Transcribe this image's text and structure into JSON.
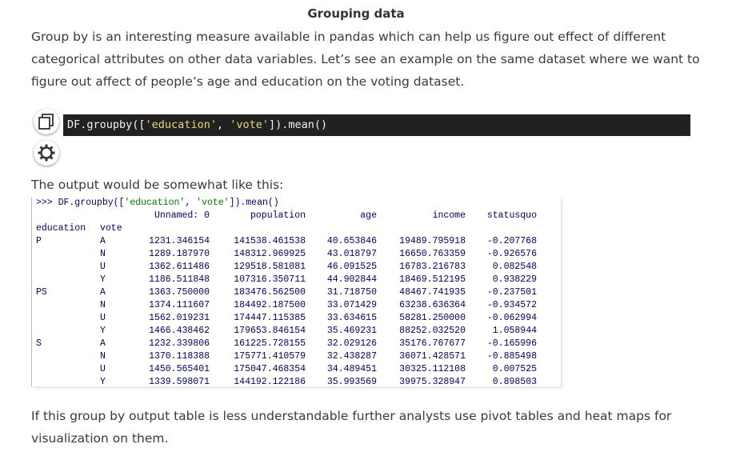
{
  "heading": "Grouping data",
  "intro": "Group by is an interesting measure available in pandas which can help us figure out effect of different categorical attributes on other data variables. Let’s see an example on the same dataset where we want to figure out affect of people’s age and education on the voting dataset.",
  "code": {
    "prefix": "DF.groupby([",
    "arg1": "'education'",
    "sep": ", ",
    "arg2": "'vote'",
    "suffix": "]).mean()"
  },
  "output_intro": "The output would be somewhat like this:",
  "output": {
    "prompt_prefix": ">>> DF.groupby([",
    "prompt_arg1": "'education'",
    "prompt_sep": ", ",
    "prompt_arg2": "'vote'",
    "prompt_suffix": "]).mean()",
    "columns": [
      "Unnamed: 0",
      "population",
      "age",
      "income",
      "statusquo"
    ],
    "index_names": [
      "education",
      "vote"
    ],
    "rows": [
      {
        "education": "P",
        "vote": "A",
        "values": [
          "1231.346154",
          "141538.461538",
          "40.653846",
          "19489.795918",
          "-0.207768"
        ]
      },
      {
        "education": "",
        "vote": "N",
        "values": [
          "1289.187970",
          "148312.969925",
          "43.018797",
          "16650.763359",
          "-0.926576"
        ]
      },
      {
        "education": "",
        "vote": "U",
        "values": [
          "1362.611486",
          "129518.581081",
          "46.091525",
          "16783.216783",
          "0.082548"
        ]
      },
      {
        "education": "",
        "vote": "Y",
        "values": [
          "1186.511848",
          "107316.350711",
          "44.902844",
          "18469.512195",
          "0.938229"
        ]
      },
      {
        "education": "PS",
        "vote": "A",
        "values": [
          "1363.750000",
          "183476.562500",
          "31.718750",
          "48467.741935",
          "-0.237501"
        ]
      },
      {
        "education": "",
        "vote": "N",
        "values": [
          "1374.111607",
          "184492.187500",
          "33.071429",
          "63238.636364",
          "-0.934572"
        ]
      },
      {
        "education": "",
        "vote": "U",
        "values": [
          "1562.019231",
          "174447.115385",
          "33.634615",
          "58281.250000",
          "-0.062994"
        ]
      },
      {
        "education": "",
        "vote": "Y",
        "values": [
          "1466.438462",
          "179653.846154",
          "35.469231",
          "88252.032520",
          "1.058944"
        ]
      },
      {
        "education": "S",
        "vote": "A",
        "values": [
          "1232.339806",
          "161225.728155",
          "32.029126",
          "35176.767677",
          "-0.165996"
        ]
      },
      {
        "education": "",
        "vote": "N",
        "values": [
          "1370.118388",
          "175771.410579",
          "32.438287",
          "36071.428571",
          "-0.885498"
        ]
      },
      {
        "education": "",
        "vote": "U",
        "values": [
          "1450.565401",
          "175047.468354",
          "34.489451",
          "30325.112108",
          "0.007525"
        ]
      },
      {
        "education": "",
        "vote": "Y",
        "values": [
          "1339.598071",
          "144192.122186",
          "35.993569",
          "39975.328947",
          "0.898503"
        ]
      }
    ]
  },
  "conclusion": "If this group by output table is less understandable further analysts use pivot tables and heat maps for visualization on them."
}
